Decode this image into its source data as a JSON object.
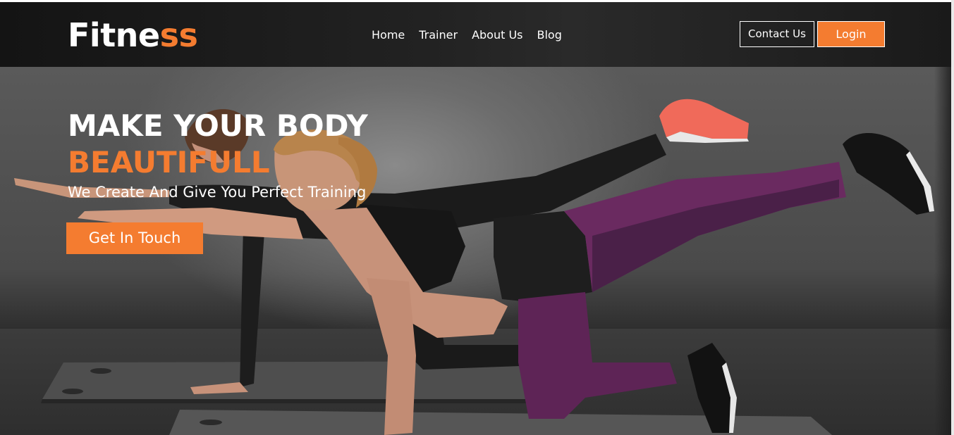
{
  "brand": {
    "logo_main": "Fitne",
    "logo_accent": "ss",
    "accent_color": "#f47c30"
  },
  "nav": {
    "links": [
      {
        "label": "Home"
      },
      {
        "label": "Trainer"
      },
      {
        "label": "About Us"
      },
      {
        "label": "Blog"
      }
    ],
    "contact_label": "Contact Us",
    "login_label": "Login"
  },
  "hero": {
    "headline_line1": "MAKE YOUR BODY",
    "headline_line2": "BEAUTIFULL",
    "tagline": "We Create And Give You Perfect Training",
    "cta_label": "Get In Touch"
  },
  "icons": {
    "hero_image": "fitness-workout-photo"
  }
}
